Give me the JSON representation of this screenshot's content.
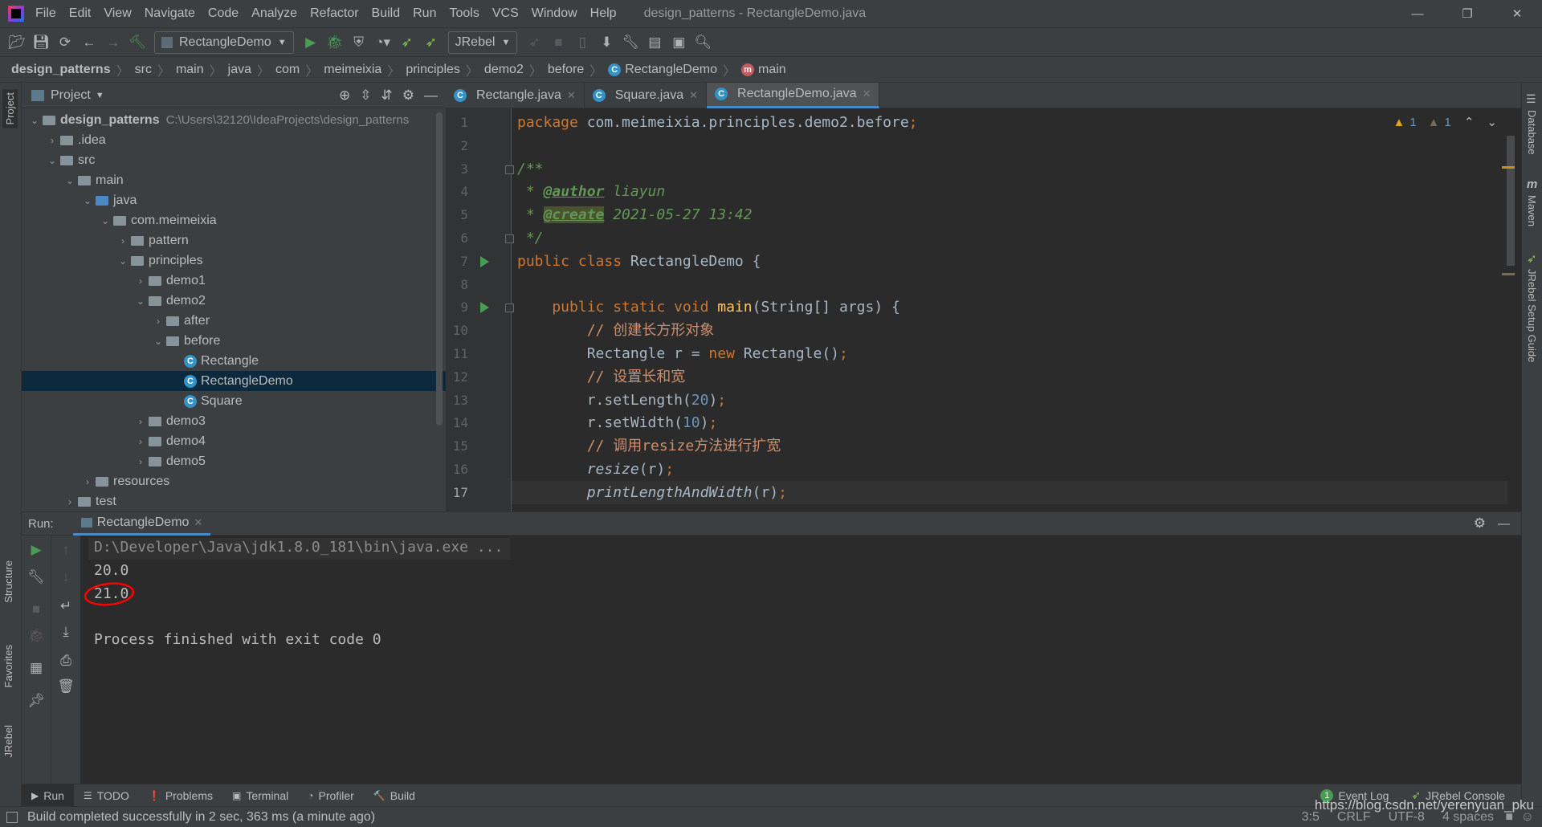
{
  "window": {
    "title": "design_patterns - RectangleDemo.java",
    "controls": [
      "—",
      "❐",
      "✕"
    ]
  },
  "menu": [
    "File",
    "Edit",
    "View",
    "Navigate",
    "Code",
    "Analyze",
    "Refactor",
    "Build",
    "Run",
    "Tools",
    "VCS",
    "Window",
    "Help"
  ],
  "toolbar": {
    "run_config": "RectangleDemo",
    "jrebel": "JRebel"
  },
  "breadcrumb": [
    "design_patterns",
    "src",
    "main",
    "java",
    "com",
    "meimeixia",
    "principles",
    "demo2",
    "before",
    "RectangleDemo",
    "main"
  ],
  "project": {
    "title": "Project",
    "root_path": "C:\\Users\\32120\\IdeaProjects\\design_patterns",
    "tree": [
      {
        "label": "design_patterns",
        "depth": 0,
        "state": "open",
        "icon": "module-folder",
        "bold": true
      },
      {
        "label": ".idea",
        "depth": 1,
        "state": "closed",
        "icon": "folder"
      },
      {
        "label": "src",
        "depth": 1,
        "state": "open",
        "icon": "folder"
      },
      {
        "label": "main",
        "depth": 2,
        "state": "open",
        "icon": "folder"
      },
      {
        "label": "java",
        "depth": 3,
        "state": "open",
        "icon": "source-folder"
      },
      {
        "label": "com.meimeixia",
        "depth": 4,
        "state": "open",
        "icon": "package"
      },
      {
        "label": "pattern",
        "depth": 5,
        "state": "closed",
        "icon": "package"
      },
      {
        "label": "principles",
        "depth": 5,
        "state": "open",
        "icon": "package"
      },
      {
        "label": "demo1",
        "depth": 6,
        "state": "closed",
        "icon": "package"
      },
      {
        "label": "demo2",
        "depth": 6,
        "state": "open",
        "icon": "package"
      },
      {
        "label": "after",
        "depth": 7,
        "state": "closed",
        "icon": "package"
      },
      {
        "label": "before",
        "depth": 7,
        "state": "open",
        "icon": "package"
      },
      {
        "label": "Rectangle",
        "depth": 8,
        "state": "none",
        "icon": "class"
      },
      {
        "label": "RectangleDemo",
        "depth": 8,
        "state": "none",
        "icon": "class-runnable",
        "selected": true
      },
      {
        "label": "Square",
        "depth": 8,
        "state": "none",
        "icon": "class"
      },
      {
        "label": "demo3",
        "depth": 6,
        "state": "closed",
        "icon": "package"
      },
      {
        "label": "demo4",
        "depth": 6,
        "state": "closed",
        "icon": "package"
      },
      {
        "label": "demo5",
        "depth": 6,
        "state": "closed",
        "icon": "package"
      },
      {
        "label": "resources",
        "depth": 3,
        "state": "closed",
        "icon": "resources-folder"
      },
      {
        "label": "test",
        "depth": 2,
        "state": "closed",
        "icon": "folder"
      }
    ]
  },
  "tabs": [
    {
      "label": "Rectangle.java"
    },
    {
      "label": "Square.java"
    },
    {
      "label": "RectangleDemo.java",
      "active": true
    }
  ],
  "inspections": {
    "warnings": "1",
    "weak_warnings": "1"
  },
  "editor": {
    "current_line": 17,
    "lines": [
      [
        [
          "kw",
          "package "
        ],
        [
          "tx",
          "com.meimeixia.principles.demo2.before"
        ],
        [
          "kw",
          ";"
        ]
      ],
      [],
      [
        [
          "doc",
          "/**"
        ]
      ],
      [
        [
          "doc",
          " * "
        ],
        [
          "tag",
          "@author"
        ],
        [
          "doc",
          " liayun"
        ]
      ],
      [
        [
          "doc",
          " * "
        ],
        [
          "tag2",
          "@create"
        ],
        [
          "doc",
          " 2021-05-27 13:42"
        ]
      ],
      [
        [
          "doc",
          " */"
        ]
      ],
      [
        [
          "kw",
          "public class "
        ],
        [
          "tx",
          "RectangleDemo {"
        ]
      ],
      [],
      [
        [
          "kw",
          "    public static void "
        ],
        [
          "fn",
          "main"
        ],
        [
          "tx",
          "(String[] args) {"
        ]
      ],
      [
        [
          "cm",
          "        // 创建长方形对象"
        ]
      ],
      [
        [
          "tx",
          "        Rectangle r = "
        ],
        [
          "kw",
          "new "
        ],
        [
          "tx",
          "Rectangle()"
        ],
        [
          "kw",
          ";"
        ]
      ],
      [
        [
          "cm",
          "        // 设置长和宽"
        ]
      ],
      [
        [
          "tx",
          "        r.setLength("
        ],
        [
          "num",
          "20"
        ],
        [
          "tx",
          ")"
        ],
        [
          "kw",
          ";"
        ]
      ],
      [
        [
          "tx",
          "        r.setWidth("
        ],
        [
          "num",
          "10"
        ],
        [
          "tx",
          ")"
        ],
        [
          "kw",
          ";"
        ]
      ],
      [
        [
          "cm",
          "        // 调用resize方法进行扩宽"
        ]
      ],
      [
        [
          "it",
          "        resize"
        ],
        [
          "tx",
          "(r)"
        ],
        [
          "kw",
          ";"
        ]
      ],
      [
        [
          "it",
          "        printLengthAndWidth"
        ],
        [
          "tx",
          "(r)"
        ],
        [
          "kw",
          ";"
        ]
      ]
    ]
  },
  "right_tools": [
    "Database",
    "Maven",
    "JRebel Setup Guide"
  ],
  "left_tools": [
    "Project",
    "Structure",
    "Favorites",
    "JRebel"
  ],
  "run": {
    "label": "Run:",
    "tab": "RectangleDemo",
    "console": [
      "D:\\Developer\\Java\\jdk1.8.0_181\\bin\\java.exe ...",
      "20.0",
      "21.0",
      "",
      "Process finished with exit code 0"
    ]
  },
  "bottom_tabs": [
    {
      "label": "Run",
      "icon": "▶",
      "active": true
    },
    {
      "label": "TODO",
      "icon": "☰"
    },
    {
      "label": "Problems",
      "icon": "❗"
    },
    {
      "label": "Terminal",
      "icon": "▣"
    },
    {
      "label": "Profiler",
      "icon": "◔"
    },
    {
      "label": "Build",
      "icon": "🔨"
    }
  ],
  "bottom_right": {
    "event_log_count": "1",
    "event_log": "Event Log",
    "jrebel_console": "JRebel Console"
  },
  "status": {
    "message": "Build completed successfully in 2 sec, 363 ms (a minute ago)",
    "position": "3:5",
    "line_sep": "CRLF",
    "encoding": "UTF-8",
    "indent": "4 spaces",
    "watermark": "https://blog.csdn.net/yerenyuan_pku"
  },
  "colors": {
    "accent": "#4a88c7",
    "selection": "#0d293e",
    "keyword": "#cc7832",
    "annotation_circle": "#ff0000"
  }
}
